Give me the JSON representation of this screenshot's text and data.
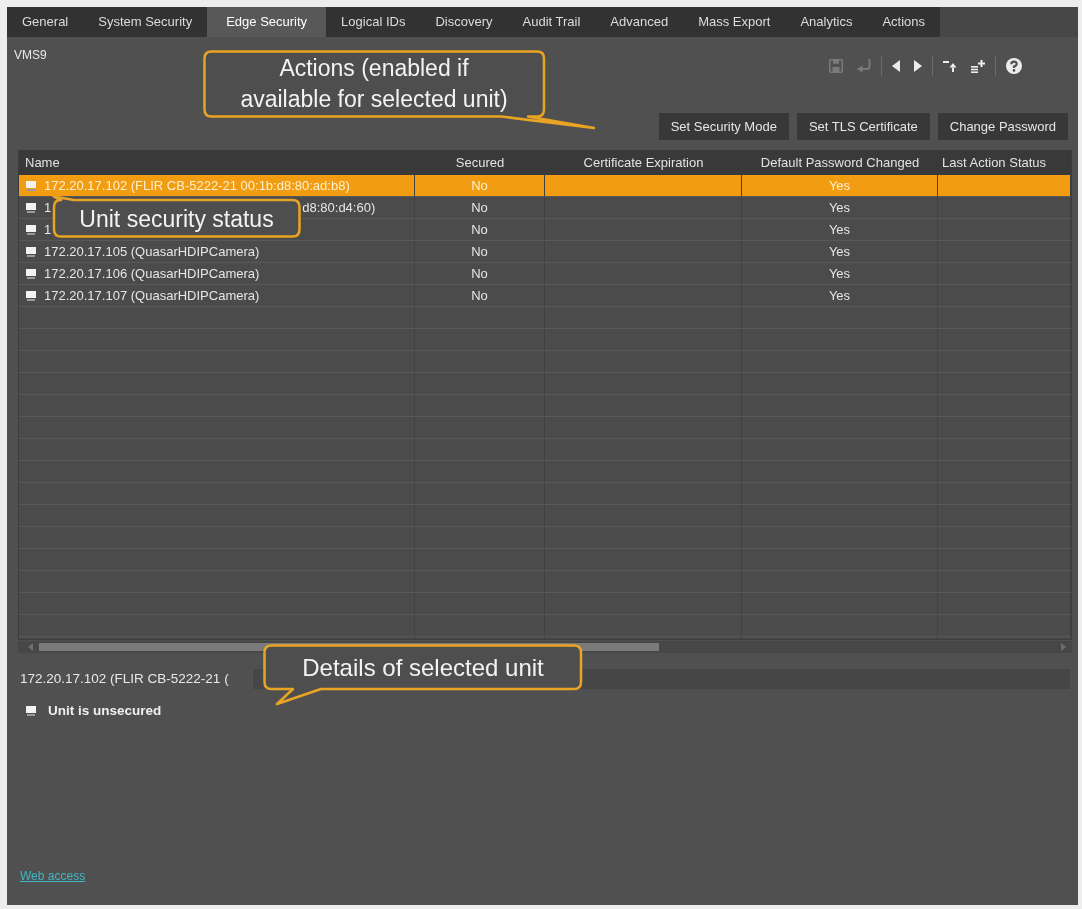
{
  "tabs": [
    {
      "label": "General",
      "selected": false
    },
    {
      "label": "System Security",
      "selected": false
    },
    {
      "label": "Edge Security",
      "selected": true
    },
    {
      "label": "Logical IDs",
      "selected": false
    },
    {
      "label": "Discovery",
      "selected": false
    },
    {
      "label": "Audit Trail",
      "selected": false
    },
    {
      "label": "Advanced",
      "selected": false
    },
    {
      "label": "Mass Export",
      "selected": false
    },
    {
      "label": "Analytics",
      "selected": false
    },
    {
      "label": "Actions",
      "selected": false
    }
  ],
  "header": {
    "title": "VMS9"
  },
  "toolbar": [
    [
      {
        "kind": "save",
        "disabled": true
      },
      {
        "kind": "undo",
        "disabled": true
      }
    ],
    [
      {
        "kind": "previous",
        "disabled": false
      },
      {
        "kind": "next",
        "disabled": false
      }
    ],
    [
      {
        "kind": "move-up",
        "disabled": false
      },
      {
        "kind": "add-list",
        "disabled": false
      }
    ],
    [
      {
        "kind": "help",
        "disabled": false
      }
    ]
  ],
  "actions": {
    "buttons": [
      "Set Security Mode",
      "Set TLS Certificate",
      "Change Password"
    ],
    "callout": "Actions (enabled if available for selected unit)"
  },
  "table": {
    "columns": [
      "Name",
      "Secured",
      "Certificate Expiration",
      "Default Password Changed",
      "Last Action Status"
    ],
    "rows": [
      {
        "name_parts": [
          "172.20.17.102 (FLIR CB-5222-21 00:1b:d8:80:ad:b8)"
        ],
        "secured": "No",
        "default_password_changed": "Yes",
        "selected": true
      },
      {
        "name_parts": [
          "1",
          "d8:80:d4:60)"
        ],
        "secured": "No",
        "default_password_changed": "Yes",
        "selected": false
      },
      {
        "name_parts": [
          "1"
        ],
        "secured": "No",
        "default_password_changed": "Yes",
        "selected": false
      },
      {
        "name_parts": [
          "172.20.17.105 (QuasarHDIPCamera)"
        ],
        "secured": "No",
        "default_password_changed": "Yes",
        "selected": false
      },
      {
        "name_parts": [
          "172.20.17.106 (QuasarHDIPCamera)"
        ],
        "secured": "No",
        "default_password_changed": "Yes",
        "selected": false
      },
      {
        "name_parts": [
          "172.20.17.107 (QuasarHDIPCamera)"
        ],
        "secured": "No",
        "default_password_changed": "Yes",
        "selected": false
      }
    ],
    "callout": "Unit security status"
  },
  "details": {
    "title": "172.20.17.102 (FLIR CB-5222-21 (",
    "status": "Unit is unsecured",
    "link": "Web access",
    "callout": "Details of selected unit"
  }
}
